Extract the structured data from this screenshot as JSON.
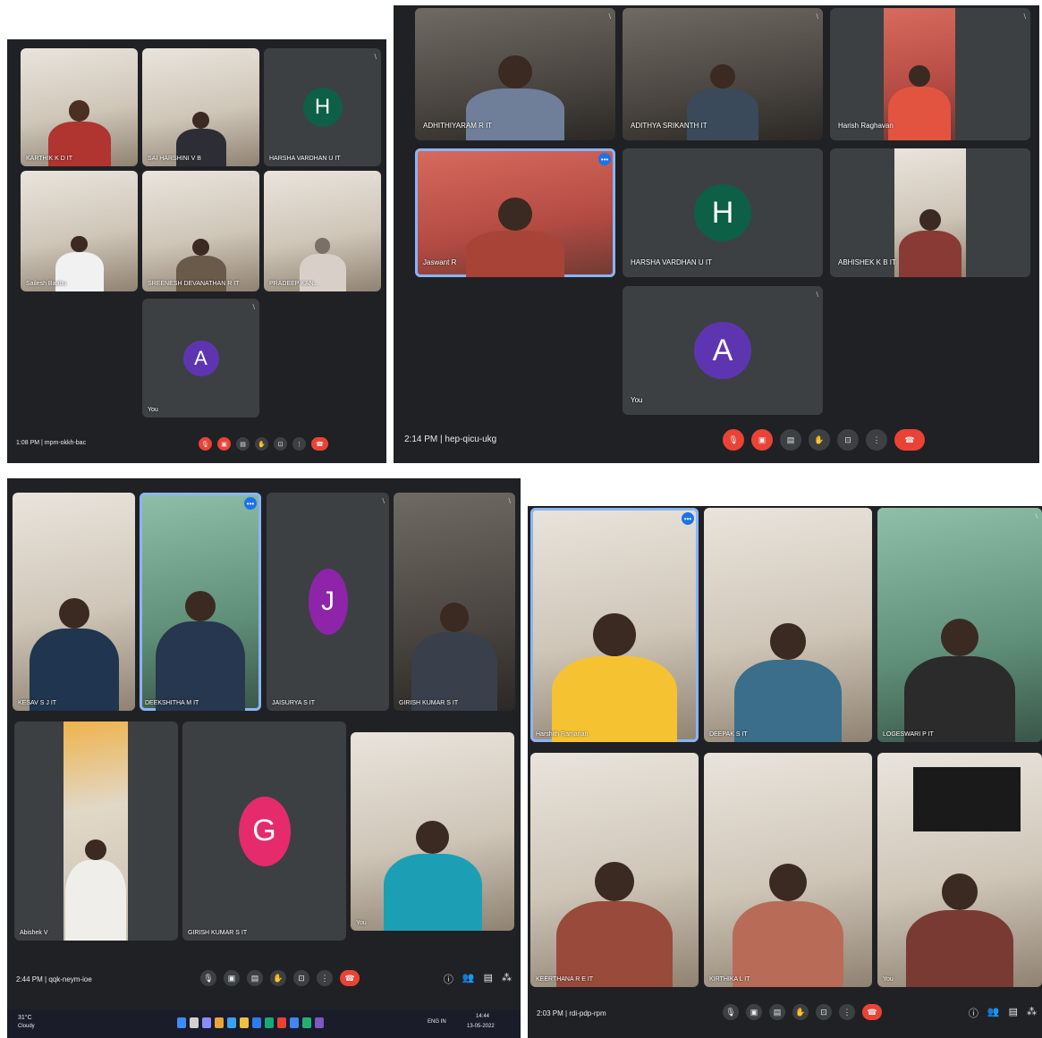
{
  "colors": {
    "background": "#202124",
    "tile": "#3c4043",
    "end_call": "#ea4335",
    "active_border": "#8ab4f8"
  },
  "shot1": {
    "meeting": "1:08 PM | mpm-okkh-bac",
    "tiles": [
      {
        "name": "KARTHIK K D IT",
        "type": "photo"
      },
      {
        "name": "SAI HARSHINI V B",
        "type": "photo"
      },
      {
        "name": "HARSHA VARDHAN U IT",
        "type": "avatar",
        "letter": "H",
        "color": "#0d5f46"
      },
      {
        "name": "Sailesh Baabu",
        "type": "photo"
      },
      {
        "name": "SREENESH DEVANATHAN R IT",
        "type": "photo"
      },
      {
        "name": "PRADEEP KAN...",
        "type": "photo"
      },
      {
        "name": "You",
        "type": "avatar",
        "letter": "A",
        "color": "#5e35b1"
      }
    ]
  },
  "shot2": {
    "meeting": "2:14 PM | hep-qicu-ukg",
    "tiles": [
      {
        "name": "ADHITHIYARAM R IT",
        "type": "photo"
      },
      {
        "name": "ADITHYA SRIKANTH IT",
        "type": "photo"
      },
      {
        "name": "Harish Raghavan",
        "type": "photo"
      },
      {
        "name": "Jaswant R",
        "type": "photo"
      },
      {
        "name": "HARSHA VARDHAN U IT",
        "type": "avatar",
        "letter": "H",
        "color": "#0d5f46"
      },
      {
        "name": "ABHISHEK K B IT",
        "type": "photo"
      },
      {
        "name": "You",
        "type": "avatar",
        "letter": "A",
        "color": "#5e35b1"
      }
    ]
  },
  "shot3": {
    "meeting": "2:44 PM | qqk-neym-ioe",
    "tiles": [
      {
        "name": "KESAV S J IT",
        "type": "photo"
      },
      {
        "name": "DEEKSHITHA M IT",
        "type": "photo"
      },
      {
        "name": "JAISURYA S IT",
        "type": "avatar",
        "letter": "J",
        "color": "#8e24aa"
      },
      {
        "name": "GIRISH KUMAR S IT",
        "type": "photo"
      },
      {
        "name": "Abishek V",
        "type": "photo"
      },
      {
        "name": "GIRISH KUMAR S IT",
        "type": "avatar",
        "letter": "G",
        "color": "#e52b6b"
      },
      {
        "name": "You",
        "type": "photo"
      }
    ],
    "taskbar": {
      "weather": "31°C",
      "weather_sub": "Cloudy",
      "tray": "ENG IN",
      "clock": "14:44",
      "date": "13-05-2022"
    }
  },
  "shot4": {
    "meeting": "2:03 PM | rdi-pdp-rpm",
    "tiles": [
      {
        "name": "Harshith Ramanan",
        "type": "photo"
      },
      {
        "name": "DEEPAK S IT",
        "type": "photo"
      },
      {
        "name": "LOGESWARI P IT",
        "type": "photo"
      },
      {
        "name": "KEERTHANA R E IT",
        "type": "photo"
      },
      {
        "name": "KIRTHIKA L IT",
        "type": "photo"
      },
      {
        "name": "You",
        "type": "photo"
      }
    ]
  }
}
